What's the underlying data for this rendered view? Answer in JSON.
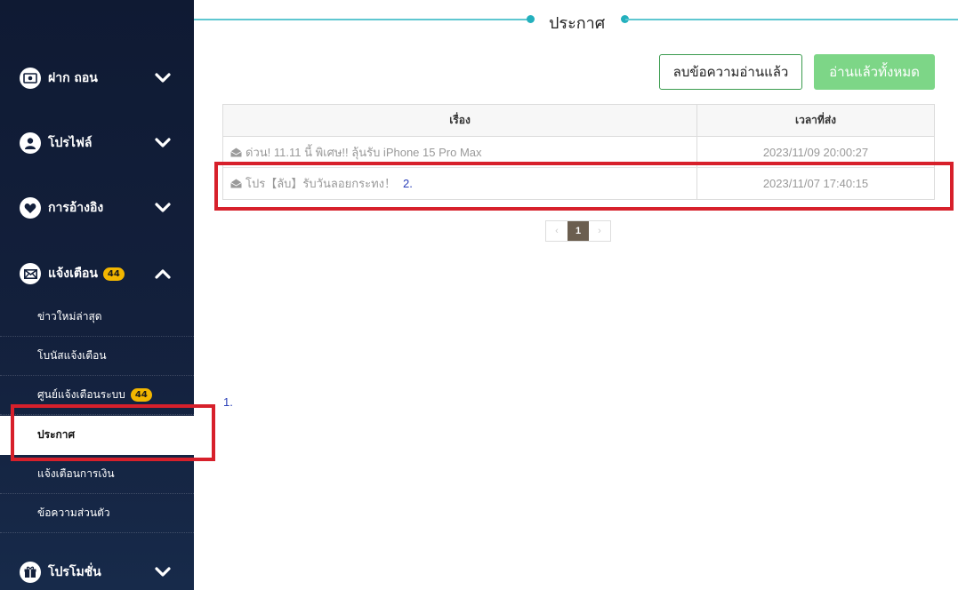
{
  "sidebar": {
    "items": [
      {
        "label": "ฝาก ถอน",
        "icon": "money-icon",
        "chevron": "down"
      },
      {
        "label": "โปรไฟล์",
        "icon": "user-icon",
        "chevron": "down"
      },
      {
        "label": "การอ้างอิง",
        "icon": "heart-icon",
        "chevron": "down"
      },
      {
        "label": "แจ้งเตือน",
        "icon": "envelope-icon",
        "chevron": "up",
        "badge": "44"
      },
      {
        "label": "โปรโมชั่น",
        "icon": "gift-icon",
        "chevron": "down"
      }
    ],
    "sub_items": [
      {
        "label": "ข่าวใหม่ล่าสุด"
      },
      {
        "label": "โบนัสแจ้งเตือน"
      },
      {
        "label": "ศูนย์แจ้งเตือนระบบ",
        "badge": "44"
      },
      {
        "label": "ประกาศ",
        "active": true
      },
      {
        "label": "แจ้งเตือนการเงิน"
      },
      {
        "label": "ข้อความส่วนตัว"
      }
    ]
  },
  "page_title": "ประกาศ",
  "toolbar": {
    "delete_read_label": "ลบข้อความอ่านแล้ว",
    "read_all_label": "อ่านแล้วทั้งหมด"
  },
  "table": {
    "headers": [
      "เรื่อง",
      "เวลาที่ส่ง"
    ],
    "rows": [
      {
        "subject": "ด่วน! 11.11 นี้ พิเศษ!! ลุ้นรับ iPhone 15 Pro Max",
        "time": "2023/11/09 20:00:27"
      },
      {
        "subject": "โปร【ลับ】รับวันลอยกระทง！",
        "time": "2023/11/07 17:40:15",
        "note": "2."
      }
    ]
  },
  "pagination": {
    "prev": "‹",
    "current": "1",
    "next": "›"
  },
  "annotations": {
    "label_1": "1."
  },
  "colors": {
    "sidebar_bg": "#13203c",
    "accent_teal": "#23b0bd",
    "badge": "#f2b600",
    "green": "#7dd687",
    "highlight_red": "#d7202b"
  }
}
